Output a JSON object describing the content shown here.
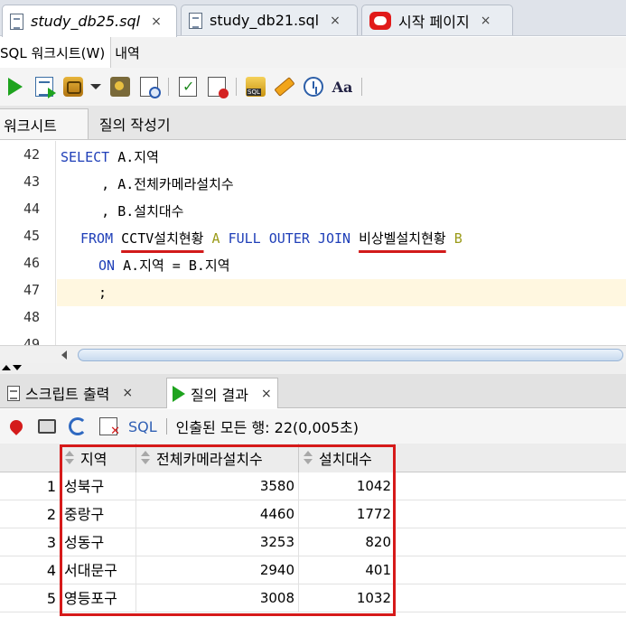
{
  "file_tabs": [
    {
      "label": "study_db25.sql",
      "close": "×"
    },
    {
      "label": "study_db21.sql",
      "close": "×"
    },
    {
      "label": "시작 페이지",
      "close": "×"
    }
  ],
  "sub_tabs": {
    "worksheet": "SQL 워크시트(W)",
    "history": "내역"
  },
  "worksheet_tabs": {
    "worksheet": "워크시트",
    "query_builder": "질의 작성기"
  },
  "editor": {
    "line_numbers": [
      "42",
      "43",
      "44",
      "45",
      "46",
      "47",
      "48",
      "49"
    ],
    "current_line": "47",
    "lines": {
      "l42_kw": "SELECT",
      "l42_rest": " A.지역",
      "l43": "     , A.전체카메라설치수",
      "l44": "     , B.설치대수",
      "l45_from": "FROM",
      "l45_t1": "CCTV설치현황",
      "l45_a": "A",
      "l45_join": "FULL OUTER JOIN",
      "l45_t2": "비상벨설치현황",
      "l45_b": "B",
      "l46_on": "ON",
      "l46_rest": " A.지역 = B.지역",
      "l47": ";"
    }
  },
  "output_tabs": {
    "script_output": "스크립트 출력",
    "query_result": "질의 결과",
    "close": "×"
  },
  "result_toolbar": {
    "sql_label": "SQL",
    "status": "인출된 모든 행: 22(0,005초)"
  },
  "grid": {
    "columns": [
      "지역",
      "전체카메라설치수",
      "설치대수"
    ],
    "rows": [
      {
        "n": "1",
        "region": "성북구",
        "cameras": "3580",
        "bells": "1042"
      },
      {
        "n": "2",
        "region": "중랑구",
        "cameras": "4460",
        "bells": "1772"
      },
      {
        "n": "3",
        "region": "성동구",
        "cameras": "3253",
        "bells": "820"
      },
      {
        "n": "4",
        "region": "서대문구",
        "cameras": "2940",
        "bells": "401"
      },
      {
        "n": "5",
        "region": "영등포구",
        "cameras": "3008",
        "bells": "1032"
      }
    ]
  },
  "colors": {
    "keyword": "#1f3fb8",
    "alias": "#9b9b1a",
    "highlight": "#d61a1a",
    "current_line": "#fff7e0"
  }
}
